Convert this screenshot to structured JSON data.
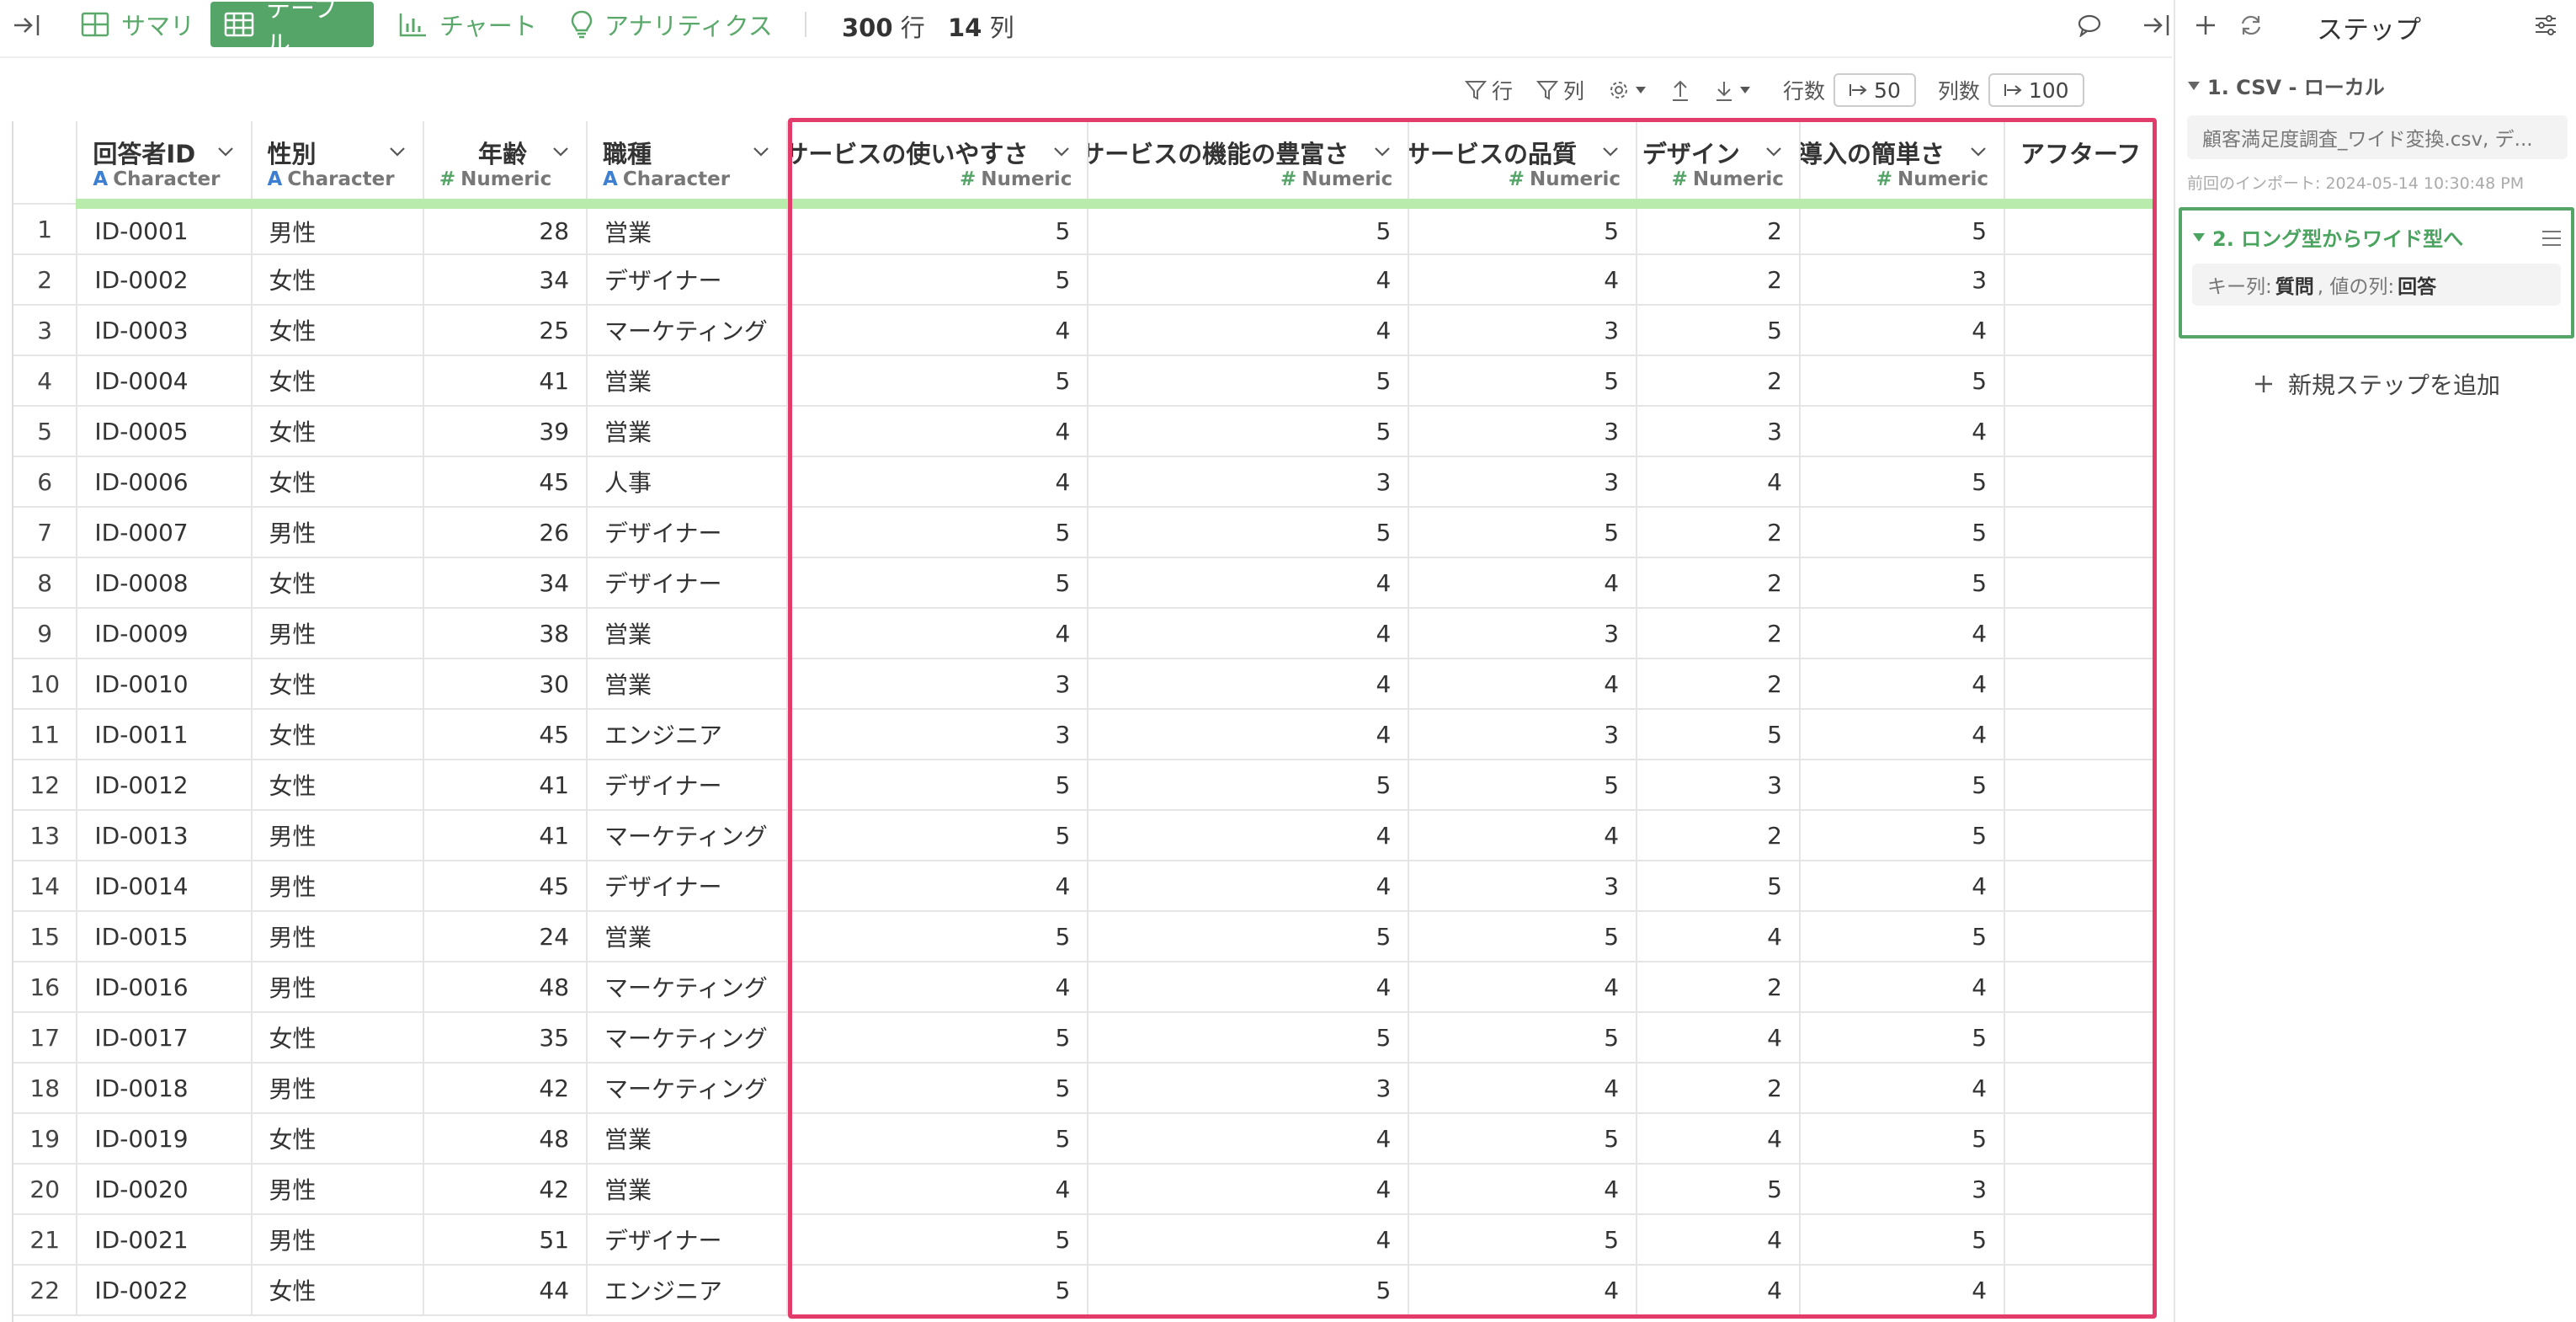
{
  "toolbar": {
    "tabs": [
      {
        "label": "サマリ",
        "active": false
      },
      {
        "label": "テーブル",
        "active": true
      },
      {
        "label": "チャート",
        "active": false
      },
      {
        "label": "アナリティクス",
        "active": false
      }
    ],
    "rows_count": "300",
    "rows_unit": "行",
    "cols_count": "14",
    "cols_unit": "列"
  },
  "subtoolbar": {
    "row_filter_label": "行",
    "col_filter_label": "列",
    "rows_label": "行数",
    "rows_value": "50",
    "cols_label": "列数",
    "cols_value": "100"
  },
  "table": {
    "columns": [
      {
        "name": "回答者ID",
        "type": "Character"
      },
      {
        "name": "性別",
        "type": "Character"
      },
      {
        "name": "年齢",
        "type": "Numeric"
      },
      {
        "name": "職種",
        "type": "Character"
      },
      {
        "name": "サービスの使いやすさ",
        "type": "Numeric"
      },
      {
        "name": "サービスの機能の豊富さ",
        "type": "Numeric"
      },
      {
        "name": "サービスの品質",
        "type": "Numeric"
      },
      {
        "name": "デザイン",
        "type": "Numeric"
      },
      {
        "name": "導入の簡単さ",
        "type": "Numeric"
      },
      {
        "name": "アフターフ",
        "type": ""
      }
    ],
    "rows": [
      [
        "1",
        "ID-0001",
        "男性",
        "28",
        "営業",
        "5",
        "5",
        "5",
        "2",
        "5",
        ""
      ],
      [
        "2",
        "ID-0002",
        "女性",
        "34",
        "デザイナー",
        "5",
        "4",
        "4",
        "2",
        "3",
        ""
      ],
      [
        "3",
        "ID-0003",
        "女性",
        "25",
        "マーケティング",
        "4",
        "4",
        "3",
        "5",
        "4",
        ""
      ],
      [
        "4",
        "ID-0004",
        "女性",
        "41",
        "営業",
        "5",
        "5",
        "5",
        "2",
        "5",
        ""
      ],
      [
        "5",
        "ID-0005",
        "女性",
        "39",
        "営業",
        "4",
        "5",
        "3",
        "3",
        "4",
        ""
      ],
      [
        "6",
        "ID-0006",
        "女性",
        "45",
        "人事",
        "4",
        "3",
        "3",
        "4",
        "5",
        ""
      ],
      [
        "7",
        "ID-0007",
        "男性",
        "26",
        "デザイナー",
        "5",
        "5",
        "5",
        "2",
        "5",
        ""
      ],
      [
        "8",
        "ID-0008",
        "女性",
        "34",
        "デザイナー",
        "5",
        "4",
        "4",
        "2",
        "5",
        ""
      ],
      [
        "9",
        "ID-0009",
        "男性",
        "38",
        "営業",
        "4",
        "4",
        "3",
        "2",
        "4",
        ""
      ],
      [
        "10",
        "ID-0010",
        "女性",
        "30",
        "営業",
        "3",
        "4",
        "4",
        "2",
        "4",
        ""
      ],
      [
        "11",
        "ID-0011",
        "女性",
        "45",
        "エンジニア",
        "3",
        "4",
        "3",
        "5",
        "4",
        ""
      ],
      [
        "12",
        "ID-0012",
        "女性",
        "41",
        "デザイナー",
        "5",
        "5",
        "5",
        "3",
        "5",
        ""
      ],
      [
        "13",
        "ID-0013",
        "男性",
        "41",
        "マーケティング",
        "5",
        "4",
        "4",
        "2",
        "5",
        ""
      ],
      [
        "14",
        "ID-0014",
        "男性",
        "45",
        "デザイナー",
        "4",
        "4",
        "3",
        "5",
        "4",
        ""
      ],
      [
        "15",
        "ID-0015",
        "男性",
        "24",
        "営業",
        "5",
        "5",
        "5",
        "4",
        "5",
        ""
      ],
      [
        "16",
        "ID-0016",
        "男性",
        "48",
        "マーケティング",
        "4",
        "4",
        "4",
        "2",
        "4",
        ""
      ],
      [
        "17",
        "ID-0017",
        "女性",
        "35",
        "マーケティング",
        "5",
        "5",
        "5",
        "4",
        "5",
        ""
      ],
      [
        "18",
        "ID-0018",
        "男性",
        "42",
        "マーケティング",
        "5",
        "3",
        "4",
        "2",
        "4",
        ""
      ],
      [
        "19",
        "ID-0019",
        "女性",
        "48",
        "営業",
        "5",
        "4",
        "5",
        "4",
        "5",
        ""
      ],
      [
        "20",
        "ID-0020",
        "男性",
        "42",
        "営業",
        "4",
        "4",
        "4",
        "5",
        "3",
        ""
      ],
      [
        "21",
        "ID-0021",
        "男性",
        "51",
        "デザイナー",
        "5",
        "4",
        "5",
        "4",
        "5",
        ""
      ],
      [
        "22",
        "ID-0022",
        "女性",
        "44",
        "エンジニア",
        "5",
        "5",
        "4",
        "4",
        "4",
        ""
      ]
    ]
  },
  "steps_panel": {
    "title": "ステップ",
    "step1": {
      "title": "1. CSV - ローカル",
      "file": "顧客満足度調査_ワイド変換.csv, デ...",
      "meta": "前回のインポート: 2024-05-14 10:30:48 PM"
    },
    "step2": {
      "title": "2. ロング型からワイド型へ",
      "key_label": "キー列:",
      "key_value": "質問",
      "value_label": ", 値の列:",
      "value_value": "回答"
    },
    "add_step_label": "新規ステップを追加"
  },
  "colors": {
    "accent": "#55a568",
    "highlight": "#e23c6a",
    "header_bar": "#b9ecac"
  }
}
